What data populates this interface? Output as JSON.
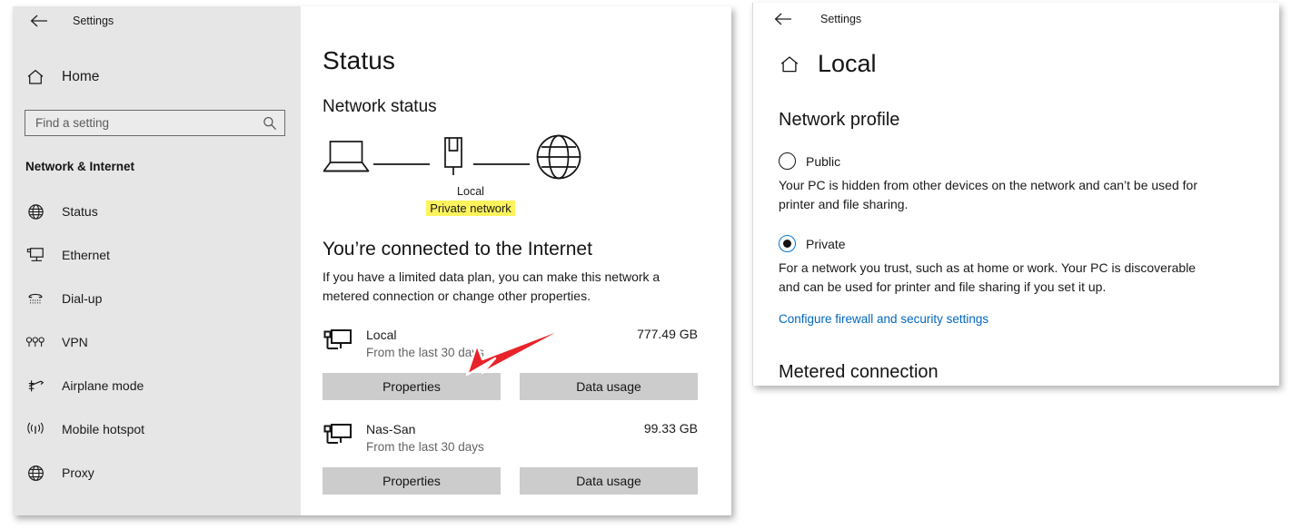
{
  "settings_window": {
    "titlebar": {
      "back_icon": "back-arrow-icon",
      "title": "Settings"
    },
    "sidebar": {
      "home": {
        "icon": "home-icon",
        "label": "Home"
      },
      "search": {
        "placeholder": "Find a setting",
        "value": "",
        "icon": "search-icon"
      },
      "section_title": "Network & Internet",
      "items": [
        {
          "label": "Status",
          "icon": "globe-icon"
        },
        {
          "label": "Ethernet",
          "icon": "ethernet-icon"
        },
        {
          "label": "Dial-up",
          "icon": "dialup-icon"
        },
        {
          "label": "VPN",
          "icon": "vpn-icon"
        },
        {
          "label": "Airplane mode",
          "icon": "airplane-icon"
        },
        {
          "label": "Mobile hotspot",
          "icon": "hotspot-icon"
        },
        {
          "label": "Proxy",
          "icon": "proxy-globe-icon"
        }
      ]
    },
    "main": {
      "page_title": "Status",
      "network_status_heading": "Network status",
      "diagram": {
        "device_icon": "laptop-icon",
        "adapter_icon": "network-adapter-icon",
        "internet_icon": "globe-icon",
        "adapter_label": "Local",
        "network_type_label": "Private network",
        "highlight_color": "#fdf35c"
      },
      "connected_title": "You’re connected to the Internet",
      "connected_desc": "If you have a limited data plan, you can make this network a metered connection or change other properties.",
      "usage_entries": [
        {
          "icon": "pc-network-icon",
          "name": "Local",
          "period": "From the last 30 days",
          "amount": "777.49 GB",
          "properties_label": "Properties",
          "data_usage_label": "Data usage"
        },
        {
          "icon": "pc-network-icon",
          "name": "Nas-San",
          "period": "From the last 30 days",
          "amount": "99.33 GB",
          "properties_label": "Properties",
          "data_usage_label": "Data usage"
        }
      ],
      "annotation": {
        "type": "red-arrow",
        "color": "#e8232a",
        "points_to": "Properties"
      }
    }
  },
  "local_window": {
    "titlebar": {
      "back_icon": "back-arrow-icon",
      "title": "Settings"
    },
    "header": {
      "icon": "home-icon",
      "title": "Local"
    },
    "network_profile": {
      "heading": "Network profile",
      "options": [
        {
          "label": "Public",
          "selected": false,
          "description": "Your PC is hidden from other devices on the network and can’t be used for printer and file sharing."
        },
        {
          "label": "Private",
          "selected": true,
          "description": "For a network you trust, such as at home or work. Your PC is discoverable and can be used for printer and file sharing if you set it up."
        }
      ],
      "firewall_link": "Configure firewall and security settings",
      "accent_color": "#0078d7",
      "link_color": "#0067c0"
    },
    "metered_heading": "Metered connection"
  }
}
